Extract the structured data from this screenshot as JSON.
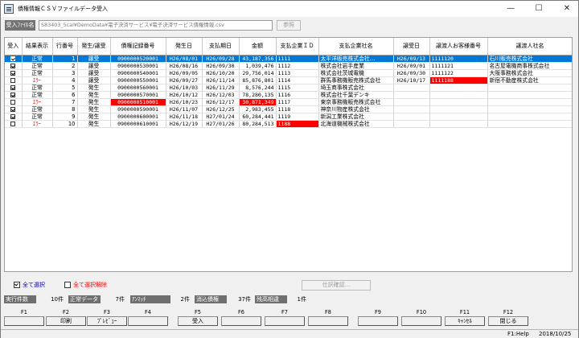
{
  "window": {
    "title": "債権情報ＣＳＶファイルデータ受入",
    "minimize": "—",
    "maximize": "☐",
    "close": "✕"
  },
  "file": {
    "label": "受入ﾌｧｲﾙ名",
    "path": "S83403_5cal¥DemoData¥電子決済サービス¥電子決済サービス債権情報.csv",
    "browse": "参照"
  },
  "table": {
    "headers": [
      "受入",
      "結果表示",
      "行番号",
      "発生/譲受",
      "債権記録番号",
      "発生日",
      "支払期日",
      "金額",
      "支払企業ＩＤ",
      "支払企業社名",
      "譲受日",
      "譲渡人お客様番号",
      "譲渡人社名"
    ],
    "rows": [
      {
        "checked": true,
        "result": "正常",
        "line": "1",
        "type": "譲受",
        "record": "0900000520001",
        "issue": "H26/08/01",
        "due": "H26/09/28",
        "amount": "43,187,356",
        "payer_id": "1111",
        "payer": "太平洋販売株式会社…",
        "assign_date": "H26/09/13",
        "assignor_no": "1111120",
        "assignor": "石川販売株式会社"
      },
      {
        "checked": true,
        "result": "正常",
        "line": "2",
        "type": "譲受",
        "record": "0900000530001",
        "issue": "H26/08/16",
        "due": "H26/09/30",
        "amount": "1,039,476",
        "payer_id": "1112",
        "payer": "株式会社岩手産業",
        "assign_date": "H26/09/01",
        "assignor_no": "1111121",
        "assignor": "名古屋電機商事株式会社"
      },
      {
        "checked": true,
        "result": "正常",
        "line": "3",
        "type": "譲受",
        "record": "0900000540001",
        "issue": "H26/09/05",
        "due": "H26/10/20",
        "amount": "29,756,014",
        "payer_id": "1113",
        "payer": "株式会社茨城電機",
        "assign_date": "H26/09/30",
        "assignor_no": "1111122",
        "assignor": "大阪事務株式会社"
      },
      {
        "checked": false,
        "result": "ｴﾗｰ",
        "line": "4",
        "type": "譲受",
        "record": "0900000550001",
        "issue": "H26/09/27",
        "due": "H26/11/14",
        "amount": "85,876,801",
        "payer_id": "1114",
        "payer": "群馬事務機販売株式会社",
        "assign_date": "H26/10/17",
        "assignor_no": "1111188",
        "assignor": "新宿不動産株式会社"
      },
      {
        "checked": true,
        "result": "正常",
        "line": "5",
        "type": "発生",
        "record": "0900000560001",
        "issue": "H26/10/03",
        "due": "H26/11/29",
        "amount": "8,576,244",
        "payer_id": "1115",
        "payer": "埼玉商事株式会社",
        "assign_date": "",
        "assignor_no": "",
        "assignor": ""
      },
      {
        "checked": true,
        "result": "正常",
        "line": "6",
        "type": "発生",
        "record": "0900000570001",
        "issue": "H26/10/12",
        "due": "H26/12/03",
        "amount": "78,280,135",
        "payer_id": "1116",
        "payer": "株式会社千葉デンキ",
        "assign_date": "",
        "assignor_no": "",
        "assignor": ""
      },
      {
        "checked": false,
        "result": "ｴﾗｰ",
        "line": "7",
        "type": "発生",
        "record": "0900000510001",
        "issue": "H26/10/23",
        "due": "H26/12/17",
        "amount": "30,871,349",
        "payer_id": "1117",
        "payer": "東京事務機販売株式会社",
        "assign_date": "",
        "assignor_no": "",
        "assignor": ""
      },
      {
        "checked": true,
        "result": "正常",
        "line": "8",
        "type": "発生",
        "record": "0900000590001",
        "issue": "H26/11/07",
        "due": "H26/12/25",
        "amount": "2,983,455",
        "payer_id": "1118",
        "payer": "神奈川物産株式会社",
        "assign_date": "",
        "assignor_no": "",
        "assignor": ""
      },
      {
        "checked": true,
        "result": "正常",
        "line": "9",
        "type": "発生",
        "record": "0900000600001",
        "issue": "H26/11/18",
        "due": "H27/01/24",
        "amount": "60,284,441",
        "payer_id": "1119",
        "payer": "新潟工業株式会社",
        "assign_date": "",
        "assignor_no": "",
        "assignor": ""
      },
      {
        "checked": false,
        "result": "ｴﾗｰ",
        "line": "10",
        "type": "発生",
        "record": "0900000610001",
        "issue": "H26/12/19",
        "due": "H27/01/26",
        "amount": "80,284,513",
        "payer_id": "1188",
        "payer": "北海道機械株式会社",
        "assign_date": "",
        "assignor_no": "",
        "assignor": ""
      }
    ]
  },
  "controls": {
    "select_all": "全て選択",
    "deselect_all": "全て選択解除",
    "journal_confirm": "仕訳確認..."
  },
  "stats": [
    {
      "label": "実行件数",
      "value": "10件"
    },
    {
      "label": "正常データ",
      "value": "7件"
    },
    {
      "label": "ｱﾝﾏｯﾁ",
      "value": "2件"
    },
    {
      "label": "消込債権",
      "value": "37件"
    },
    {
      "label": "残高相違",
      "value": "1件"
    }
  ],
  "fkeys": [
    {
      "key": "F1",
      "label": ""
    },
    {
      "key": "F2",
      "label": "印刷"
    },
    {
      "key": "F3",
      "label": "ﾌﾟﾚﾋﾞｭｰ"
    },
    {
      "key": "F4",
      "label": ""
    },
    {
      "key": "F5",
      "label": "受入"
    },
    {
      "key": "F6",
      "label": ""
    },
    {
      "key": "F7",
      "label": ""
    },
    {
      "key": "F8",
      "label": ""
    },
    {
      "key": "F9",
      "label": ""
    },
    {
      "key": "F10",
      "label": ""
    },
    {
      "key": "F11",
      "label": "ｷｬﾝｾﾙ"
    },
    {
      "key": "F12",
      "label": "閉じる"
    }
  ],
  "status": {
    "help": "F1:Help",
    "date": "2018/10/25"
  },
  "colors": {
    "selection": "#0078d7",
    "error": "#ff0000",
    "label_bg": "#737373"
  }
}
